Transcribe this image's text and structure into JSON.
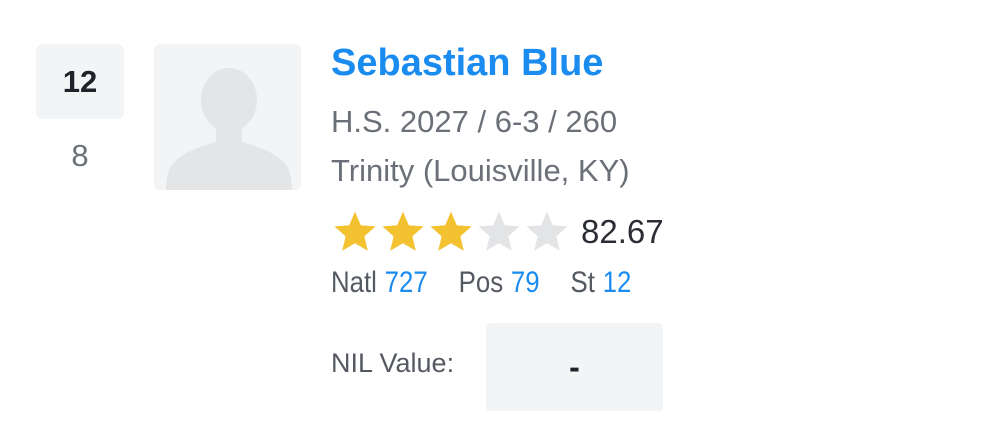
{
  "rank": {
    "current": "12",
    "previous": "8"
  },
  "player": {
    "name": "Sebastian Blue",
    "class_size": "H.S. 2027 / 6-3 / 260",
    "school": "Trinity (Louisville, KY)",
    "avatar_icon": "person-silhouette-icon"
  },
  "rating": {
    "stars_filled": 3,
    "stars_total": 5,
    "score": "82.67",
    "star_color": "#f2c230",
    "star_empty_color": "#e3e4e6"
  },
  "ranks": {
    "natl_label": "Natl",
    "natl_value": "727",
    "pos_label": "Pos",
    "pos_value": "79",
    "st_label": "St",
    "st_value": "12"
  },
  "nil": {
    "label": "NIL Value:",
    "value": "-"
  },
  "colors": {
    "accent": "#1a8cf0",
    "panel_bg": "#f3f4f6"
  }
}
